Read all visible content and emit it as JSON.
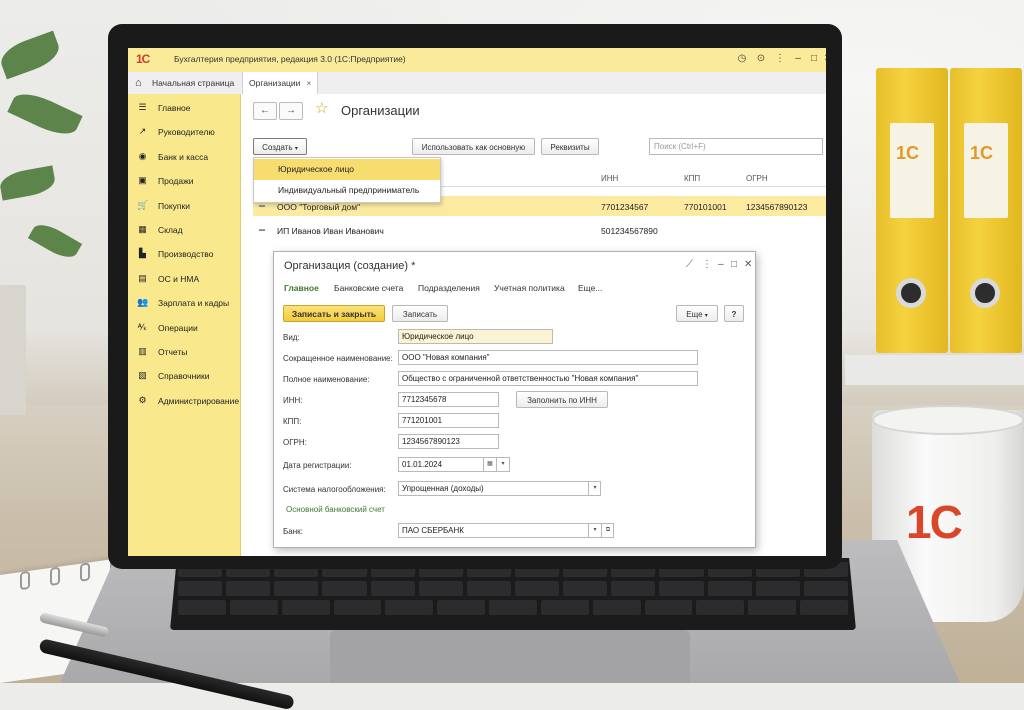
{
  "app": {
    "title": "Бухгалтерия предприятия, редакция 3.0  (1С:Предприятие)",
    "logo": "1С"
  },
  "tabs": {
    "home": "Начальная страница",
    "current": "Организации"
  },
  "sidebar": {
    "items": [
      {
        "icon": "menu-icon",
        "glyph": "☰",
        "label": "Главное"
      },
      {
        "icon": "chart-icon",
        "glyph": "↗",
        "label": "Руководителю"
      },
      {
        "icon": "bank-icon",
        "glyph": "◉",
        "label": "Банк и касса"
      },
      {
        "icon": "bag-icon",
        "glyph": "▣",
        "label": "Продажи"
      },
      {
        "icon": "cart-icon",
        "glyph": "🛒",
        "label": "Покупки"
      },
      {
        "icon": "warehouse-icon",
        "glyph": "▦",
        "label": "Склад"
      },
      {
        "icon": "factory-icon",
        "glyph": "▙",
        "label": "Производство"
      },
      {
        "icon": "assets-icon",
        "glyph": "▤",
        "label": "ОС и НМА"
      },
      {
        "icon": "people-icon",
        "glyph": "👥",
        "label": "Зарплата и кадры"
      },
      {
        "icon": "operations-icon",
        "glyph": "ᴬ⁄ₖ",
        "label": "Операции"
      },
      {
        "icon": "reports-icon",
        "glyph": "▥",
        "label": "Отчеты"
      },
      {
        "icon": "book-icon",
        "glyph": "▧",
        "label": "Справочники"
      },
      {
        "icon": "gear-icon",
        "glyph": "⚙",
        "label": "Администрирование"
      }
    ]
  },
  "list": {
    "title": "Организации",
    "create_label": "Создать",
    "use_main_label": "Использовать как основную",
    "details_label": "Реквизиты",
    "search_placeholder": "Поиск (Ctrl+F)",
    "columns": {
      "inn": "ИНН",
      "kpp": "КПП",
      "ogrn": "ОГРН"
    },
    "rows": [
      {
        "name": "ООО \"Торговый дом\"",
        "inn": "7701234567",
        "kpp": "770101001",
        "ogrn": "1234567890123"
      },
      {
        "name": "ИП Иванов Иван Иванович",
        "inn": "501234567890",
        "kpp": "",
        "ogrn": ""
      }
    ],
    "create_menu": [
      "Юридическое лицо",
      "Индивидуальный предприниматель"
    ]
  },
  "dialog": {
    "title": "Организация (создание) *",
    "tabs": [
      "Главное",
      "Банковские счета",
      "Подразделения",
      "Учетная политика",
      "Еще..."
    ],
    "save_close_label": "Записать и закрыть",
    "save_label": "Записать",
    "more_label": "Еще",
    "help_label": "?",
    "fill_by_inn_label": "Заполнить по ИНН",
    "bank_section": "Основной банковский счет",
    "fields": {
      "kind": {
        "label": "Вид:",
        "value": "Юридическое лицо"
      },
      "short_name": {
        "label": "Сокращенное наименование:",
        "value": "ООО \"Новая компания\""
      },
      "full_name": {
        "label": "Полное наименование:",
        "value": "Общество с ограниченной ответственностью \"Новая компания\""
      },
      "inn": {
        "label": "ИНН:",
        "value": "7712345678"
      },
      "kpp": {
        "label": "КПП:",
        "value": "771201001"
      },
      "ogrn": {
        "label": "ОГРН:",
        "value": "1234567890123"
      },
      "reg_date": {
        "label": "Дата регистрации:",
        "value": "01.01.2024"
      },
      "tax_system": {
        "label": "Система налогообложения:",
        "value": "Упрощенная (доходы)"
      },
      "bank": {
        "label": "Банк:",
        "value": "ПАО СБЕРБАНК"
      }
    }
  },
  "decor": {
    "binder_logo": "1С",
    "mug_logo": "1С"
  },
  "colors": {
    "sidebar": "#f9e98c",
    "accent_yellow": "#f3cd3a",
    "selected_row": "#fbeaa0",
    "green_text": "#3a7a2c",
    "brand_red": "#d33b2a"
  }
}
